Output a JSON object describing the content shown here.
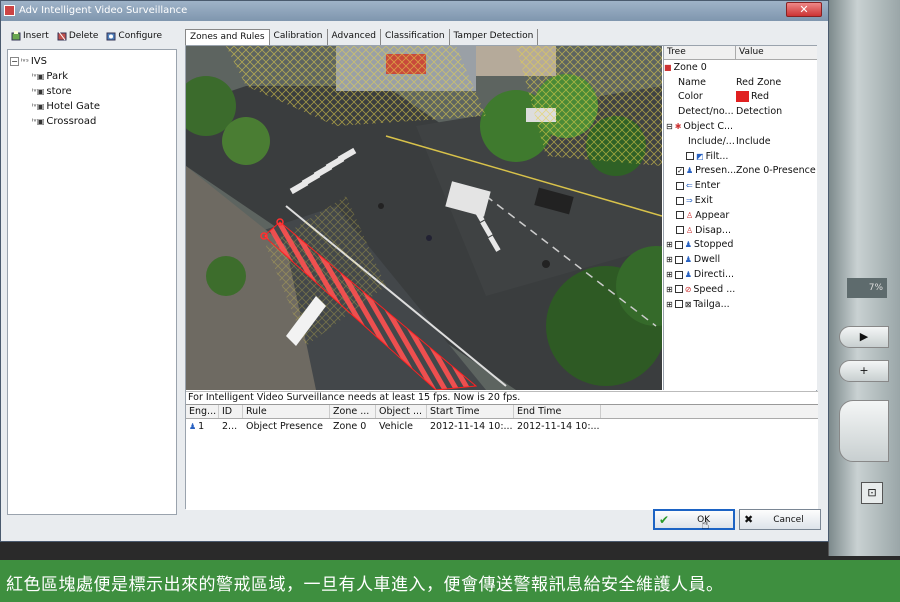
{
  "window": {
    "title": "Adv Intelligent Video Surveillance",
    "close_label": "✕"
  },
  "toolbar": {
    "insert": "Insert",
    "delete": "Delete",
    "configure": "Configure"
  },
  "tree": {
    "root": "IVS",
    "items": [
      "Park",
      "store",
      "Hotel Gate",
      "Crossroad"
    ]
  },
  "tabs": [
    "Zones and Rules",
    "Calibration",
    "Advanced",
    "Classification",
    "Tamper Detection"
  ],
  "props": {
    "header": {
      "tree": "Tree",
      "value": "Value"
    },
    "zone": "Zone 0",
    "rows": [
      {
        "k": "Name",
        "v": "Red Zone"
      },
      {
        "k": "Color",
        "v": "Red",
        "color": "#e02020"
      },
      {
        "k": "Detect/no...",
        "v": "Detection"
      },
      {
        "k": "Object C...",
        "v": ""
      },
      {
        "k": "Include/...",
        "v": "Include"
      },
      {
        "k": "Filt...",
        "v": ""
      },
      {
        "k": "Presen...",
        "v": "Zone 0-Presence",
        "checked": true
      },
      {
        "k": "Enter",
        "v": ""
      },
      {
        "k": "Exit",
        "v": ""
      },
      {
        "k": "Appear",
        "v": ""
      },
      {
        "k": "Disap...",
        "v": ""
      },
      {
        "k": "Stopped",
        "v": ""
      },
      {
        "k": "Dwell",
        "v": ""
      },
      {
        "k": "Directi...",
        "v": ""
      },
      {
        "k": "Speed ...",
        "v": ""
      },
      {
        "k": "Tailga...",
        "v": ""
      }
    ]
  },
  "status": "For Intelligent Video Surveillance needs at least 15 fps. Now is 20 fps.",
  "table": {
    "columns": [
      "Eng...",
      "ID",
      "Rule",
      "Zone ...",
      "Object ...",
      "Start Time",
      "End Time"
    ],
    "rows": [
      [
        "1",
        "2...",
        "Object Presence",
        "Zone 0",
        "Vehicle",
        "2012-11-14 10:...",
        "2012-11-14 10:..."
      ]
    ]
  },
  "buttons": {
    "ok": "OK",
    "cancel": "Cancel"
  },
  "device": {
    "percent": "7%"
  },
  "caption": "紅色區塊處便是標示出來的警戒區域，一旦有人車進入，便會傳送警報訊息給安全維護人員。"
}
